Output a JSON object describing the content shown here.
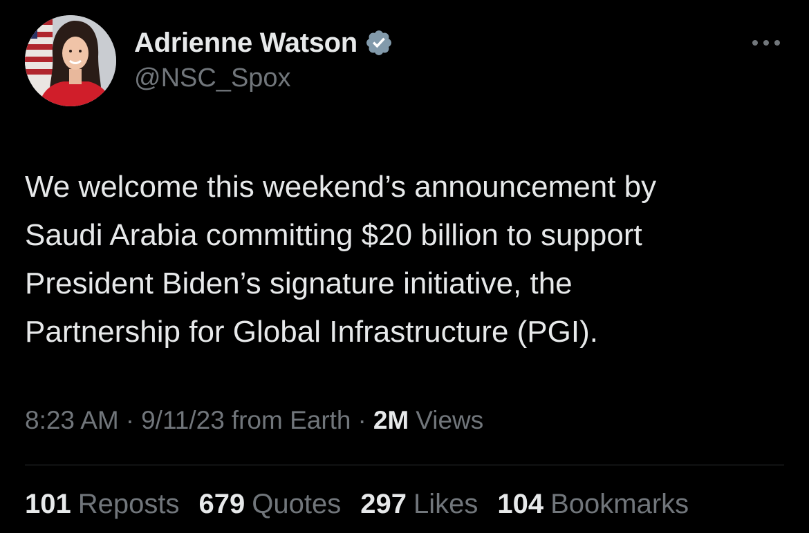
{
  "author": {
    "display_name": "Adrienne Watson",
    "handle": "@NSC_Spox",
    "verified_badge_icon": "verified-badge-icon",
    "verified_color": "#829aab"
  },
  "menu": {
    "icon": "more-horizontal-icon"
  },
  "tweet": {
    "text": "We welcome this weekend’s announcement by\nSaudi Arabia committing $20 billion to support\nPresident Biden’s signature initiative, the\nPartnership for Global Infrastructure (PGI)."
  },
  "meta": {
    "time": "8:23 AM",
    "separator": "·",
    "date": "9/11/23",
    "source": "from Earth",
    "views_count": "2M",
    "views_label": "Views"
  },
  "stats": [
    {
      "count": "101",
      "label": "Reposts"
    },
    {
      "count": "679",
      "label": "Quotes"
    },
    {
      "count": "297",
      "label": "Likes"
    },
    {
      "count": "104",
      "label": "Bookmarks"
    }
  ],
  "colors": {
    "background": "#000000",
    "primary_text": "#e7e9ea",
    "secondary_text": "#71767b",
    "divider": "#2f3336"
  }
}
